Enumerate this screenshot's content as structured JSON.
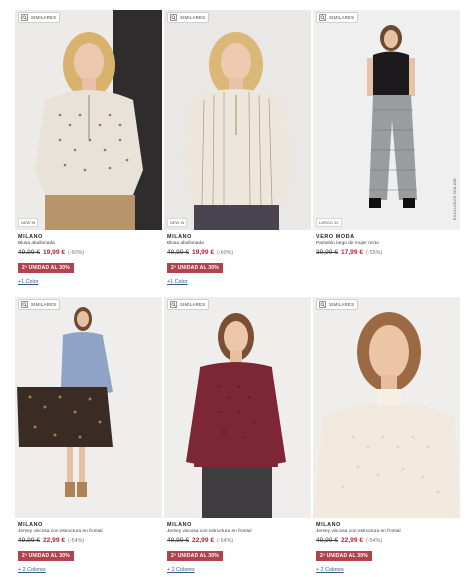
{
  "similar_label": "SIMILARES",
  "promo_label": "2ª UNIDAD AL 30%",
  "colors": {
    "sale_price": "#b5243e",
    "promo_bg": "#b2424d",
    "link": "#3a5a8c"
  },
  "products": [
    {
      "brand": "MILANO",
      "desc": "Blusa abullonada",
      "old_price": "49,99 €",
      "new_price": "19,99 €",
      "discount": "(-60%)",
      "tag": "NEW IN",
      "colors_link": "+1 Color"
    },
    {
      "brand": "MILANO",
      "desc": "Blusa abullonada",
      "old_price": "49,99 €",
      "new_price": "19,99 €",
      "discount": "(-60%)",
      "tag": "NEW IN",
      "colors_link": "+1 Color"
    },
    {
      "brand": "VERO MODA",
      "desc": "Pantalón largo de mujer recto",
      "old_price": "39,99 €",
      "new_price": "17,99 €",
      "discount": "(-55%)",
      "tag": "LARGO 32",
      "side_text": "EXCLUSIVO ONLINE",
      "colors_link": ""
    },
    {
      "brand": "MILANO",
      "desc": "Jersey viscosa con estructura en frontal",
      "old_price": "49,99 €",
      "new_price": "22,99 €",
      "discount": "(-54%)",
      "colors_link": "+ 2 Colores"
    },
    {
      "brand": "MILANO",
      "desc": "Jersey viscosa con estructura en frontal",
      "old_price": "49,99 €",
      "new_price": "22,99 €",
      "discount": "(-54%)",
      "colors_link": "+ 2 Colores"
    },
    {
      "brand": "MILANO",
      "desc": "Jersey viscosa con estructura en frontal",
      "old_price": "49,99 €",
      "new_price": "22,99 €",
      "discount": "(-54%)",
      "colors_link": "+ 2 Colores"
    }
  ]
}
